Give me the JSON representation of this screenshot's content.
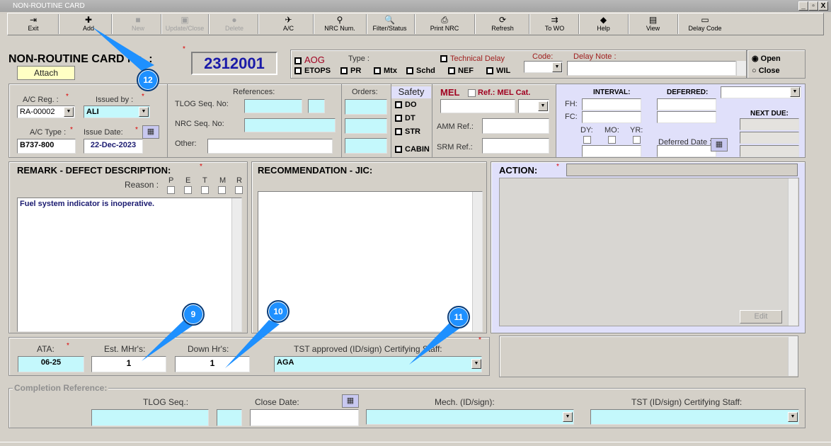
{
  "window": {
    "title": "NON-ROUTINE CARD",
    "minimize": "_",
    "maximize": "▫",
    "close": "X"
  },
  "toolbar": [
    {
      "label": "Exit",
      "icon": "exit-icon",
      "glyph": "⇥",
      "enabled": true
    },
    {
      "label": "Add",
      "icon": "plus-icon",
      "glyph": "✚",
      "enabled": true
    },
    {
      "label": "New",
      "icon": "new-icon",
      "glyph": "■",
      "enabled": false
    },
    {
      "label": "Update/Close",
      "icon": "save-icon",
      "glyph": "▣",
      "enabled": false
    },
    {
      "label": "Delete",
      "icon": "delete-icon",
      "glyph": "●",
      "enabled": false
    },
    {
      "label": "A/C",
      "icon": "aircraft-icon",
      "glyph": "✈",
      "enabled": true
    },
    {
      "label": "NRC Num.",
      "icon": "nrc-num-icon",
      "glyph": "⚲",
      "enabled": true
    },
    {
      "label": "Filter/Status",
      "icon": "magnifier-icon",
      "glyph": "🔍",
      "enabled": true
    },
    {
      "label": "Print NRC",
      "icon": "printer-icon",
      "glyph": "⎙",
      "enabled": true
    },
    {
      "label": "Refresh",
      "icon": "refresh-icon",
      "glyph": "⟳",
      "enabled": true
    },
    {
      "label": "To WO",
      "icon": "to-wo-icon",
      "glyph": "⇉",
      "enabled": true
    },
    {
      "label": "Help",
      "icon": "help-book-icon",
      "glyph": "◆",
      "enabled": true
    },
    {
      "label": "View",
      "icon": "view-icon",
      "glyph": "▤",
      "enabled": true
    },
    {
      "label": "Delay Code",
      "icon": "delay-code-icon",
      "glyph": "▭",
      "enabled": true
    }
  ],
  "header": {
    "title": "NON-ROUTINE CARD No. :",
    "attach": "Attach",
    "card_no": "2312001",
    "req": "*"
  },
  "type_group": {
    "aog": "AOG",
    "type_label": "Type :",
    "etops": "ETOPS",
    "pr": "PR",
    "mtx": "Mtx",
    "schd": "Schd",
    "nef": "NEF",
    "wil": "WIL",
    "tech_delay": "Technical Delay",
    "code_label": "Code:",
    "code_value": "",
    "delay_note_label": "Delay Note :",
    "delay_note": ""
  },
  "status": {
    "open": "Open",
    "close": "Close",
    "selected": "Open"
  },
  "aircraft": {
    "reg_label": "A/C Reg. :",
    "reg": "RA-00002",
    "issued_label": "Issued by :",
    "issued": "ALI",
    "type_label": "A/C Type :",
    "type": "B737-800",
    "date_label": "Issue Date:",
    "date": "22-Dec-2023"
  },
  "references": {
    "title": "References:",
    "tlog": "TLOG Seq. No:",
    "nrc": "NRC Seq. No:",
    "other": "Other:",
    "orders": "Orders:"
  },
  "safety": {
    "title": "Safety",
    "items": [
      "DO",
      "DT",
      "STR",
      "CABIN"
    ]
  },
  "mel": {
    "title": "MEL",
    "ref_cat": "Ref.: MEL Cat.",
    "amm": "AMM Ref.:",
    "srm": "SRM Ref.:"
  },
  "interval": {
    "title": "INTERVAL:",
    "deferred": "DEFERRED:",
    "fh": "FH:",
    "fc": "FC:",
    "dy": "DY:",
    "mo": "MO:",
    "yr": "YR:",
    "deferred_date": "Deferred Date :",
    "next_due": "NEXT DUE:"
  },
  "remark": {
    "title": "REMARK - DEFECT DESCRIPTION:",
    "reason": "Reason :",
    "reasons": [
      "P",
      "E",
      "T",
      "M",
      "R"
    ],
    "text": "Fuel system indicator is inoperative."
  },
  "recommendation": {
    "title": "RECOMMENDATION - JIC:",
    "text": ""
  },
  "action": {
    "title": "ACTION:",
    "edit": "Edit"
  },
  "work": {
    "ata_label": "ATA:",
    "ata": "06-25",
    "mhrs_label": "Est. MHr's:",
    "mhrs": "1",
    "down_label": "Down Hr's:",
    "down": "1",
    "tst_label": "TST approved (ID/sign) Certifying Staff:",
    "tst": "AGA"
  },
  "completion": {
    "title": "Completion Reference:",
    "tlog": "TLOG Seq.:",
    "close_date": "Close Date:",
    "mech": "Mech. (ID/sign):",
    "tst": "TST (ID/sign) Certifying Staff:"
  },
  "callouts": [
    "12",
    "9",
    "10",
    "11"
  ]
}
